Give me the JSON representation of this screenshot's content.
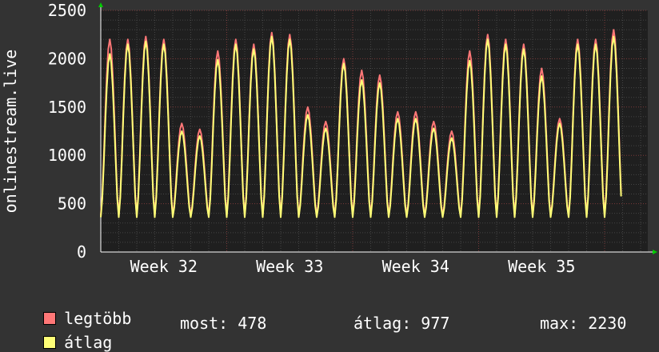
{
  "chart_data": {
    "type": "line",
    "ylabel": "onlinestream.live",
    "ylim": [
      0,
      2500
    ],
    "yticks": [
      0,
      500,
      1000,
      1500,
      2000,
      2500
    ],
    "week_labels": [
      "Week 32",
      "Week 33",
      "Week 34",
      "Week 35"
    ],
    "x_range_weeks": [
      31.5,
      35.98
    ],
    "grid": true,
    "series": [
      {
        "name": "legtöbb",
        "color": "#ff7777",
        "day_peaks": [
          2200,
          2200,
          2230,
          2200,
          1330,
          1270,
          2080,
          2200,
          2150,
          2270,
          2250,
          1500,
          1350,
          2000,
          1880,
          1830,
          1450,
          1450,
          1350,
          1250,
          2080,
          2250,
          2200,
          2150,
          1900,
          1380,
          2200,
          2200,
          2300
        ]
      },
      {
        "name": "átlag",
        "color": "#ffff77",
        "day_peaks": [
          2050,
          2150,
          2180,
          2150,
          1250,
          1200,
          1990,
          2150,
          2100,
          2230,
          2200,
          1420,
          1280,
          1950,
          1780,
          1750,
          1380,
          1380,
          1280,
          1180,
          1980,
          2200,
          2150,
          2100,
          1820,
          1330,
          2150,
          2150,
          2230
        ]
      }
    ]
  },
  "legend": {
    "max_label": "legtöbb",
    "avg_label": "átlag"
  },
  "stats": {
    "most": "most: 478",
    "atlag": "átlag: 977",
    "max": "max: 2230"
  }
}
